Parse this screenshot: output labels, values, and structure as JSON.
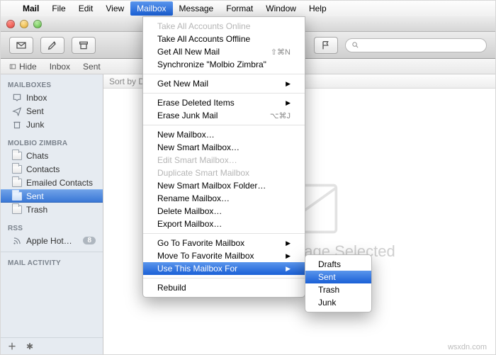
{
  "menubar": {
    "app": "Mail",
    "items": [
      "File",
      "Edit",
      "View",
      "Mailbox",
      "Message",
      "Format",
      "Window",
      "Help"
    ],
    "active_index": 3
  },
  "favorites": {
    "hide": "Hide",
    "inbox": "Inbox",
    "sent": "Sent"
  },
  "search": {
    "placeholder": ""
  },
  "sidebar": {
    "section_mailboxes": "MAILBOXES",
    "mb_items": [
      {
        "label": "Inbox",
        "icon": "inbox"
      },
      {
        "label": "Sent",
        "icon": "sent"
      },
      {
        "label": "Junk",
        "icon": "junk"
      }
    ],
    "section_account": "MOLBIO ZIMBRA",
    "acc_items": [
      {
        "label": "Chats"
      },
      {
        "label": "Contacts"
      },
      {
        "label": "Emailed Contacts"
      },
      {
        "label": "Sent",
        "selected": true
      },
      {
        "label": "Trash"
      }
    ],
    "section_rss": "RSS",
    "rss_items": [
      {
        "label": "Apple Hot…",
        "badge": "8"
      }
    ],
    "section_activity": "MAIL ACTIVITY"
  },
  "list": {
    "sort_label": "Sort by Da"
  },
  "content": {
    "no_selection_full": "No Message Selected",
    "visible_tail": "ssage Selected"
  },
  "menu": {
    "groups": [
      [
        {
          "label": "Take All Accounts Online",
          "disabled": true
        },
        {
          "label": "Take All Accounts Offline"
        },
        {
          "label": "Get All New Mail",
          "shortcut": "⇧⌘N"
        },
        {
          "label": "Synchronize \"Molbio Zimbra\""
        }
      ],
      [
        {
          "label": "Get New Mail",
          "submenu": true
        }
      ],
      [
        {
          "label": "Erase Deleted Items",
          "submenu": true
        },
        {
          "label": "Erase Junk Mail",
          "shortcut": "⌥⌘J"
        }
      ],
      [
        {
          "label": "New Mailbox…"
        },
        {
          "label": "New Smart Mailbox…"
        },
        {
          "label": "Edit Smart Mailbox…",
          "disabled": true
        },
        {
          "label": "Duplicate Smart Mailbox",
          "disabled": true
        },
        {
          "label": "New Smart Mailbox Folder…"
        },
        {
          "label": "Rename Mailbox…"
        },
        {
          "label": "Delete Mailbox…"
        },
        {
          "label": "Export Mailbox…"
        }
      ],
      [
        {
          "label": "Go To Favorite Mailbox",
          "submenu": true
        },
        {
          "label": "Move To Favorite Mailbox",
          "submenu": true
        },
        {
          "label": "Use This Mailbox For",
          "submenu": true,
          "highlight": true
        }
      ],
      [
        {
          "label": "Rebuild"
        }
      ]
    ]
  },
  "submenu": {
    "items": [
      "Drafts",
      "Sent",
      "Trash",
      "Junk"
    ],
    "highlight_index": 1
  },
  "watermark": "wsxdn.com"
}
